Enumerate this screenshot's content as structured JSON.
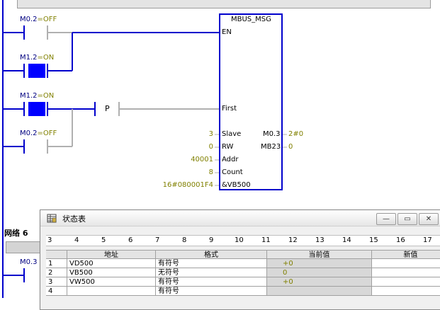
{
  "ladder": {
    "contact1": {
      "name": "M0.2",
      "state": "=OFF"
    },
    "contact2": {
      "name": "M1.2",
      "state": "=ON"
    },
    "contact3": {
      "name": "M1.2",
      "state": "=ON"
    },
    "contact4": {
      "name": "M0.2",
      "state": "=OFF"
    },
    "contact5": {
      "name": "M0.3"
    },
    "p_contact": "P",
    "network_title": "网络 6"
  },
  "block": {
    "title": "MBUS_MSG",
    "pins_left": [
      "EN",
      "First",
      "Slave",
      "RW",
      "Addr",
      "Count",
      "&VB500"
    ],
    "pins_values": {
      "Slave": "3",
      "RW": "0",
      "Addr": "40001",
      "Count": "8",
      "DataPtr": "16#080001F4"
    },
    "pins_right": [
      {
        "name": "M0.3",
        "value": "2#0"
      },
      {
        "name": "MB23",
        "value": "0"
      }
    ]
  },
  "status_window": {
    "title": "状态表",
    "buttons": {
      "minimize": "—",
      "restore": "▭",
      "close": "✕"
    },
    "ruler": [
      "3",
      "4",
      "5",
      "6",
      "7",
      "8",
      "9",
      "10",
      "11",
      "12",
      "13",
      "14",
      "15",
      "16",
      "17"
    ],
    "columns": [
      "",
      "地址",
      "格式",
      "当前值",
      "新值"
    ],
    "rows": [
      {
        "num": "1",
        "addr": "VD500",
        "fmt": "有符号",
        "cur": "+0",
        "new": ""
      },
      {
        "num": "2",
        "addr": "VB500",
        "fmt": "无符号",
        "cur": "0",
        "new": ""
      },
      {
        "num": "3",
        "addr": "VW500",
        "fmt": "有符号",
        "cur": "+0",
        "new": ""
      },
      {
        "num": "4",
        "addr": "",
        "fmt": "有符号",
        "cur": "",
        "new": ""
      }
    ]
  },
  "colors": {
    "wire_active": "#0000cc",
    "wire_inactive": "#b0b0b0",
    "label": "#000080",
    "state": "#808000"
  }
}
